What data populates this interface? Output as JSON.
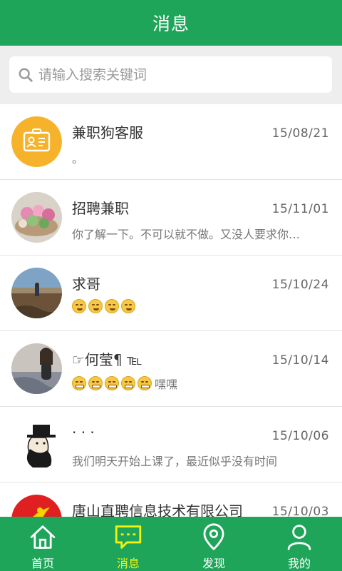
{
  "header": {
    "title": "消息"
  },
  "search": {
    "placeholder": "请输入搜索关键词",
    "value": ""
  },
  "messages": [
    {
      "name": "兼职狗客服",
      "date": "15/08/21",
      "preview": "。",
      "avatar": "service-badge-icon"
    },
    {
      "name": "招聘兼职",
      "date": "15/11/01",
      "preview": "你了解一下。不可以就不做。又没人要求你…",
      "avatar": "flower-photo"
    },
    {
      "name": "求哥",
      "date": "15/10/24",
      "preview": "",
      "emojis": 4,
      "emoji_style": "smirk",
      "avatar": "landscape-photo"
    },
    {
      "name": "☞何莹¶ ℡",
      "date": "15/10/14",
      "preview": "嘿嘿",
      "emojis": 5,
      "emoji_style": "grin",
      "avatar": "woman-photo"
    },
    {
      "name": "· · ·",
      "date": "15/10/06",
      "preview": "我们明天开始上课了，最近似乎没有时间",
      "avatar": "cartoon-hat-man"
    },
    {
      "name": "唐山直聘信息技术有限公司",
      "date": "15/10/03",
      "preview": "",
      "avatar": "company-logo"
    }
  ],
  "tabs": [
    {
      "label": "首页",
      "icon": "home-icon",
      "active": false
    },
    {
      "label": "消息",
      "icon": "chat-icon",
      "active": true
    },
    {
      "label": "发现",
      "icon": "location-pin-icon",
      "active": false
    },
    {
      "label": "我的",
      "icon": "user-icon",
      "active": false
    }
  ],
  "colors": {
    "brand_green": "#1ea55a",
    "active_tab": "#f3f30e",
    "badge_orange": "#f6b22a"
  }
}
